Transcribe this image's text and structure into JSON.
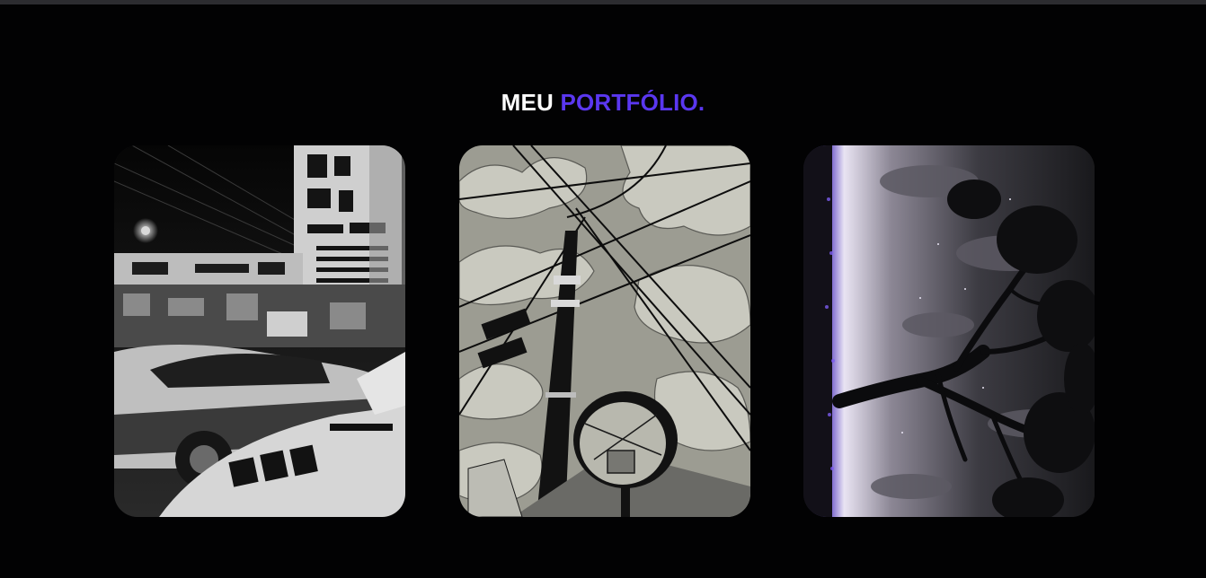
{
  "portfolio": {
    "title_part1": "MEU",
    "title_part2": "PORTFÓLIO.",
    "accent_color": "#5a37f0",
    "background_color": "#020203",
    "items": [
      {
        "icon": "street-cars-artwork"
      },
      {
        "icon": "power-lines-mirror-artwork"
      },
      {
        "icon": "tree-night-sky-artwork"
      }
    ]
  }
}
